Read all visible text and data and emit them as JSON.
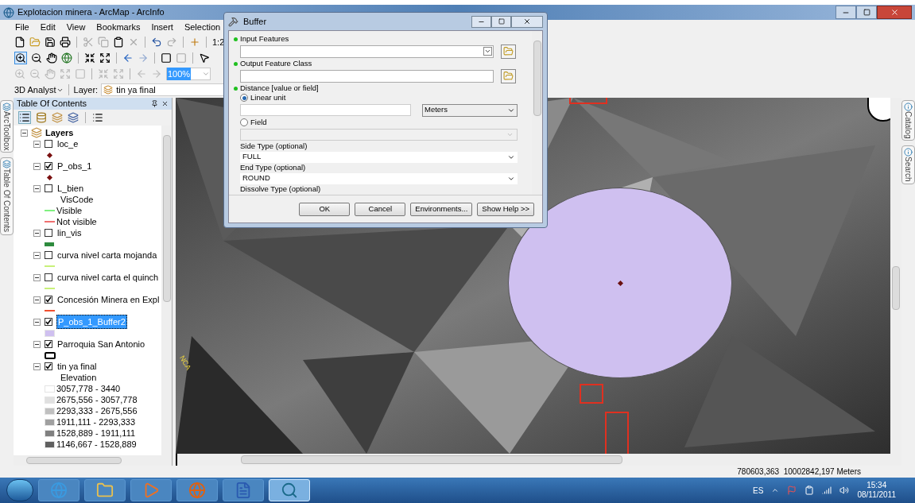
{
  "window": {
    "title": "Explotacion minera - ArcMap - ArcInfo"
  },
  "menu": [
    "File",
    "Edit",
    "View",
    "Bookmarks",
    "Insert",
    "Selection"
  ],
  "toolbar": {
    "scale_partial": "1:2",
    "zoom_field": "100%",
    "analyst": "3D Analyst",
    "layer_label": "Layer:",
    "layer_value": "tin ya final"
  },
  "side_tabs_left": [
    "ArcToolbox",
    "Table Of Contents"
  ],
  "side_tabs_right": [
    "Catalog",
    "Search"
  ],
  "toc": {
    "title": "Table Of Contents",
    "frame": {
      "name": "Layers",
      "expanded": true
    },
    "layers": [
      {
        "name": "loc_e",
        "checked": false,
        "expanded": true,
        "selected": false,
        "legend": [
          {
            "kind": "point",
            "color": "#7a1010"
          }
        ]
      },
      {
        "name": "P_obs_1",
        "checked": true,
        "expanded": true,
        "selected": false,
        "legend": [
          {
            "kind": "point",
            "color": "#7a1010"
          }
        ]
      },
      {
        "name": "L_bien",
        "checked": false,
        "expanded": true,
        "selected": false,
        "heading": "VisCode",
        "legend": [
          {
            "kind": "line",
            "color": "#80f080",
            "label": "Visible"
          },
          {
            "kind": "line",
            "color": "#f07070",
            "label": "Not visible"
          }
        ]
      },
      {
        "name": "lin_vis",
        "checked": false,
        "expanded": true,
        "selected": false,
        "legend": [
          {
            "kind": "bar",
            "color": "#2e8b3e"
          }
        ]
      },
      {
        "name": "curva nivel carta mojanda",
        "checked": false,
        "expanded": true,
        "selected": false,
        "legend": [
          {
            "kind": "line",
            "color": "#c8f07a"
          }
        ]
      },
      {
        "name": "curva nivel carta el quinch",
        "checked": false,
        "expanded": true,
        "selected": false,
        "legend": [
          {
            "kind": "line",
            "color": "#c8f07a"
          }
        ]
      },
      {
        "name": "Concesión Minera en Expl",
        "checked": true,
        "expanded": true,
        "selected": false,
        "legend": [
          {
            "kind": "line",
            "color": "#f05030"
          }
        ]
      },
      {
        "name": "P_obs_1_Buffer2",
        "checked": true,
        "expanded": true,
        "selected": true,
        "legend": [
          {
            "kind": "fill",
            "color": "#cfc0f0"
          }
        ]
      },
      {
        "name": "Parroquia San Antonio",
        "checked": true,
        "expanded": true,
        "selected": false,
        "legend": [
          {
            "kind": "outline",
            "color": "#000000"
          }
        ]
      },
      {
        "name": "tin ya final",
        "checked": true,
        "expanded": true,
        "selected": false,
        "heading": "Elevation",
        "legend": [
          {
            "kind": "fill",
            "color": "#ffffff",
            "label": "3057,778 - 3440"
          },
          {
            "kind": "fill",
            "color": "#e0e0e0",
            "label": "2675,556 - 3057,778"
          },
          {
            "kind": "fill",
            "color": "#c0c0c0",
            "label": "2293,333 - 2675,556"
          },
          {
            "kind": "fill",
            "color": "#a0a0a0",
            "label": "1911,111 - 2293,333"
          },
          {
            "kind": "fill",
            "color": "#808080",
            "label": "1528,889 - 1911,111"
          },
          {
            "kind": "fill",
            "color": "#606060",
            "label": "1146,667 - 1528,889"
          }
        ]
      }
    ]
  },
  "map": {
    "label": "NCA"
  },
  "dialog": {
    "title": "Buffer",
    "params": [
      {
        "kind": "combo-browse",
        "label": "Input Features",
        "required": true
      },
      {
        "kind": "text-browse",
        "label": "Output Feature Class",
        "required": true
      },
      {
        "kind": "heading",
        "label": "Distance [value or field]",
        "required": true
      },
      {
        "kind": "radio",
        "label": "Linear unit",
        "selected": true
      },
      {
        "kind": "value-unit",
        "unit": "Meters"
      },
      {
        "kind": "radio",
        "label": "Field",
        "selected": false
      },
      {
        "kind": "disabled-combo"
      },
      {
        "kind": "select",
        "label": "Side Type (optional)",
        "value": "FULL"
      },
      {
        "kind": "select",
        "label": "End Type (optional)",
        "value": "ROUND"
      },
      {
        "kind": "heading",
        "label": "Dissolve Type (optional)",
        "required": false
      }
    ],
    "buttons": [
      "OK",
      "Cancel",
      "Environments...",
      "Show Help >>"
    ]
  },
  "status_bar": {
    "coordinates": "780603,363  10002842,197 Meters"
  },
  "taskbar": {
    "apps": [
      {
        "kind": "browser-e",
        "selected": false
      },
      {
        "kind": "folder",
        "selected": false
      },
      {
        "kind": "media",
        "selected": false
      },
      {
        "kind": "browser-fox",
        "selected": false
      },
      {
        "kind": "document",
        "selected": false
      },
      {
        "kind": "globe-search",
        "selected": true
      }
    ],
    "language": "ES",
    "time": "15:34",
    "date": "08/11/2011"
  }
}
